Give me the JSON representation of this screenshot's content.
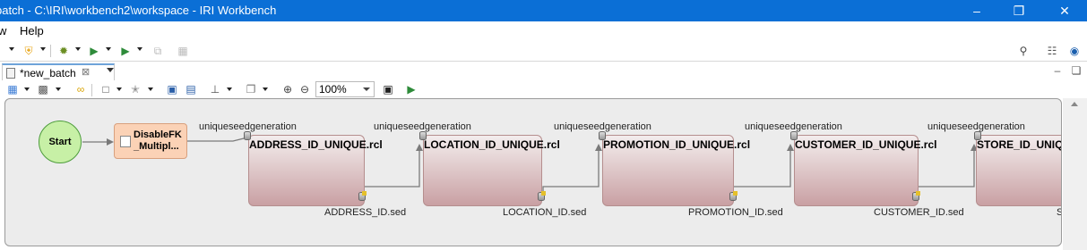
{
  "window": {
    "title": "batch - C:\\IRI\\workbench2\\workspace - IRI Workbench",
    "minimize_icon": "minimize-icon",
    "restore_icon": "restore-icon",
    "close_icon": "close-icon"
  },
  "menu": {
    "items": [
      "w",
      "Help"
    ]
  },
  "editor": {
    "tab_label": "*new_batch",
    "zoom": "100%"
  },
  "diagram": {
    "start_label": "Start",
    "first_task": [
      "DisableFK",
      "_Multipl..."
    ],
    "edge_label": "uniqueseedgeneration",
    "nodes": [
      {
        "name": "ADDRESS_ID_UNIQUE.rcl",
        "output": "ADDRESS_ID.sed"
      },
      {
        "name": "LOCATION_ID_UNIQUE.rcl",
        "output": "LOCATION_ID.sed"
      },
      {
        "name": "PROMOTION_ID_UNIQUE.rcl",
        "output": "PROMOTION_ID.sed"
      },
      {
        "name": "CUSTOMER_ID_UNIQUE.rcl",
        "output": "CUSTOMER_ID.sed"
      },
      {
        "name": "STORE_ID_UNIQUE.rcl",
        "output": "S"
      }
    ]
  },
  "colors": {
    "titlebar": "#0b6fd6",
    "start_fill": "#c7f0a6",
    "task_fill": "#fbd2b6",
    "node_fill": "#c9a0a3"
  }
}
